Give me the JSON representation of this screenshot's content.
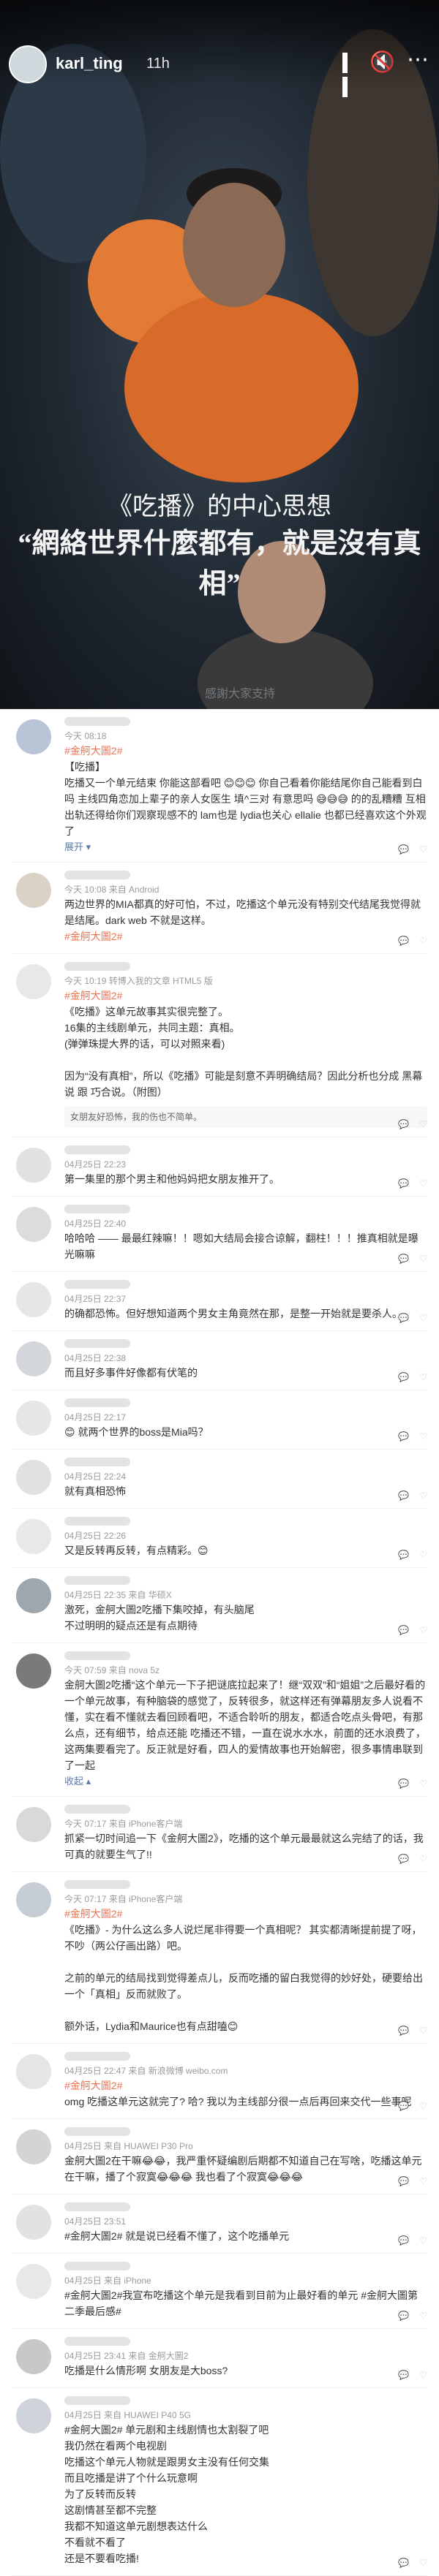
{
  "story": {
    "username": "karl_ting",
    "time": "11h",
    "caption_line1": "《吃播》的中心思想",
    "caption_line2": "“網絡世界什麼都有，就是沒有真相”",
    "watermark": "感謝大家支持"
  },
  "comments": [
    {
      "meta": "今天 08:18",
      "lead": "#金舸大圖2#",
      "text": "【吃播】\n吃播又一个单元结束 你能这部看吧 😊😊😊 你自己看着你能结尾你自己能看到白吗 主线四角恋加上辈子的亲人女医生 填^三对 有意思吗 😅😅😅 的的乱糟糟 互相出轨还得给你们观察现感不的 lam也是 lydia也关心 ellalie 也都已经喜欢这个外观了",
      "more": "展开 ▾",
      "avatar_color": "#b9c4d6"
    },
    {
      "meta": "今天 10:08 来自 Android",
      "text": "两边世界的MIA都真的好可怕，不过，吃播这个单元没有特别交代结尾我觉得就是结尾。dark web 不就是这样。",
      "tag": "#金舸大圖2#",
      "avatar_color": "#d9d2c5"
    },
    {
      "meta": "今天 10:19 转博入我的文章 HTML5 版",
      "lead": "#金舸大圖2#",
      "text": "《吃播》这单元故事其实很完整了。\n16集的主线剧单元，共同主题：真相。\n(弹弹珠提大界的话，可以对照来看)\n\n因为“没有真相”，所以《吃播》可能是刻意不弄明确结局？因此分析也分成 黑幕说 跟 巧合说。（附图）",
      "sub": "女朋友好恐怖，我的伤也不简单。",
      "avatar_color": "#e8e8e8"
    },
    {
      "meta": "04月25日 22:23",
      "text": "第一集里的那个男主和他妈妈把女朋友推开了。",
      "avatar_color": "#e2e2e2"
    },
    {
      "meta": "04月25日 22:40",
      "text": "哈哈哈 —— 最最红辣嘛！！嗯如大结局会接合谅解，翻柱！！！推真相就是曝光嘛嘛",
      "avatar_color": "#dcdcdc"
    },
    {
      "meta": "04月25日 22:37",
      "text": "的确都恐怖。但好想知道两个男女主角竟然在那，是整一开始就是要杀人。",
      "avatar_color": "#e6e6e6"
    },
    {
      "meta": "04月25日 22:38",
      "text": "而且好多事件好像都有伏笔的",
      "avatar_color": "#d3d7dc"
    },
    {
      "meta": "04月25日 22:17",
      "text": "😊 就两个世界的boss是Mia吗？",
      "avatar_color": "#e6e6e6"
    },
    {
      "meta": "04月25日 22:24",
      "text": "就有真相恐怖",
      "avatar_color": "#e1e1e1"
    },
    {
      "meta": "04月25日 22:26",
      "text": "又是反转再反转，有点精彩。😊",
      "avatar_color": "#e8e8e8"
    },
    {
      "meta": "04月25日 22:35 来自 华硕X",
      "text": "激死，金舸大圖2吃播下集咬掉，有头脑尾\n不过明明的疑点还是有点期待",
      "avatar_color": "#9ea7ae"
    },
    {
      "meta": "今天 07:59 来自 nova 5z",
      "text": "金舸大圖2吃播“这个单元一下子把谜底拉起来了！继“双双”和“姐姐”之后最好看的一个单元故事，有种脑袋的感觉了，反转很多，就这样还有弹幕朋友多人说看不懂，实在看不懂就去看回顾看吧，不适合聆听的朋友，都适合吃点头骨吧，有那么点，还有细节，给点还能 吃播还不错，一直在说水水水，前面的还水浪费了，这两集要看完了。反正就是好看，四人的爱情故事也开始解密，很多事情串联到了一起 ",
      "more": "收起 ▴",
      "avatar_color": "#7a7a7a"
    },
    {
      "meta": "今天 07:17 来自 iPhone客户端",
      "text": "抓紧一切时间追一下《金舸大圖2》，吃播的这个单元最最就这么完结了的话，我可真的就要生气了!!",
      "avatar_color": "#d9d9d9"
    },
    {
      "meta": "今天 07:17 来自 iPhone客户端",
      "lead": "#金舸大圖2#",
      "text": "《吃播》- 为什么这么多人说烂尾非得要一个真相呢？ 其实都清晰提前提了呀，不吵（两公仔画出路）吧。\n\n之前的单元的结局找到觉得差点儿，反而吃播的留白我觉得的妙好处，硬要给出一个「真相」反而就败了。\n\n额外话，Lydia和Maurice也有点甜嗑😊",
      "avatar_color": "#c7cdd4"
    },
    {
      "meta": "04月25日 22:47 来自 新浪微博 weibo.com",
      "lead": "#金舸大圖2#",
      "text": "omg 吃播这单元这就完了? 哈? 我以为主线部分很一点后再回来交代一些事呢",
      "avatar_color": "#e5e5e5"
    },
    {
      "meta": "04月25日 来自 HUAWEI P30 Pro",
      "text": "金舸大圖2在干嘛😂😂，我严重怀疑编剧后期都不知道自己在写啥，吃播这单元在干嘛，播了个寂寞😂😂😂 我也看了个寂寞😂😂😂",
      "avatar_color": "#d4d4d4"
    },
    {
      "meta": "04月25日 23:51",
      "text": "#金舸大圖2# 就是说已经看不懂了，这个吃播单元",
      "avatar_color": "#e2e2e2"
    },
    {
      "meta": "04月25日 来自 iPhone",
      "text": "#金舸大圖2#我宣布吃播这个单元是我看到目前为止最好看的单元 #金舸大圖第二季最后感#",
      "avatar_color": "#e8e8e8"
    },
    {
      "meta": "04月25日 23:41 来自 金舸大圖2",
      "text": "吃播是什么情形啊 女朋友是大boss?",
      "avatar_color": "#c8c8c8"
    },
    {
      "meta": "04月25日 来自 HUAWEI P40 5G",
      "text": "#金舸大圖2# 单元剧和主线剧情也太割裂了吧\n我仍然在看两个电视剧\n吃播这个单元人物就是跟男女主没有任何交集\n而且吃播是讲了个什么玩意啊\n为了反转而反转\n这剧情甚至都不完整\n我都不知道这单元剧想表达什么\n不看就不看了\n还是不要看吃播!",
      "avatar_color": "#cfd4da"
    }
  ]
}
